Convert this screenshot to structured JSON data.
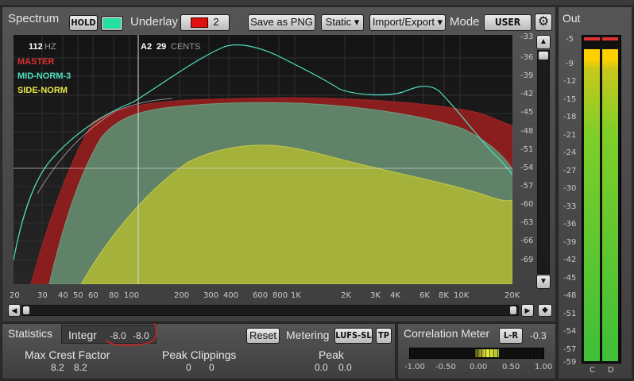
{
  "spectrum": {
    "title": "Spectrum",
    "hold_label": "HOLD",
    "underlay_label": "Underlay",
    "underlay_value": "2",
    "save_label": "Save as PNG",
    "static_label": "Static ▾",
    "import_export_label": "Import/Export ▾",
    "mode_label": "Mode",
    "mode_value": "USER",
    "hold_color": "#22e0a0",
    "underlay_color": "#e01010",
    "cursor_freq": "112",
    "cursor_freq_unit": "HZ",
    "cursor_note": "A2",
    "cursor_cents": "29",
    "cursor_cents_unit": "CENTS",
    "legend": [
      {
        "name": "MASTER",
        "color": "#e03030"
      },
      {
        "name": "MID-NORM-3",
        "color": "#4fe0c0"
      },
      {
        "name": "SIDE-NORM",
        "color": "#e8e84a"
      }
    ],
    "x_ticks": [
      "20",
      "30",
      "40",
      "50",
      "60",
      "80",
      "100",
      "200",
      "300",
      "400",
      "600",
      "800",
      "1K",
      "2K",
      "3K",
      "4K",
      "6K",
      "8K",
      "10K",
      "20K"
    ],
    "y_ticks": [
      "-33",
      "-36",
      "-39",
      "-42",
      "-45",
      "-48",
      "-51",
      "-54",
      "-57",
      "-60",
      "-63",
      "-66",
      "-69"
    ]
  },
  "out_meter": {
    "title": "Out",
    "scale": [
      "-5",
      "-9",
      "-12",
      "-15",
      "-18",
      "-21",
      "-24",
      "-27",
      "-30",
      "-33",
      "-36",
      "-39",
      "-42",
      "-45",
      "-48",
      "-51",
      "-54",
      "-57",
      "-59"
    ],
    "channels": [
      "C",
      "D"
    ]
  },
  "statistics": {
    "title": "Statistics",
    "integr_label": "Integr",
    "integr_left": "-8.0",
    "integr_right": "-8.0",
    "reset_label": "Reset",
    "metering_label": "Metering",
    "metering_value": "LUFS-SL",
    "tp_label": "TP",
    "max_crest_label": "Max Crest Factor",
    "max_crest_left": "8.2",
    "max_crest_right": "8.2",
    "peak_clip_label": "Peak Clippings",
    "peak_clip_left": "0",
    "peak_clip_right": "0",
    "peak_label": "Peak",
    "peak_left": "0.0",
    "peak_right": "0.0"
  },
  "correlation": {
    "title": "Correlation Meter",
    "mode": "L-R",
    "value": "-0.3",
    "ticks": [
      "-1.00",
      "-0.50",
      "0.00",
      "0.50",
      "1.00"
    ]
  }
}
